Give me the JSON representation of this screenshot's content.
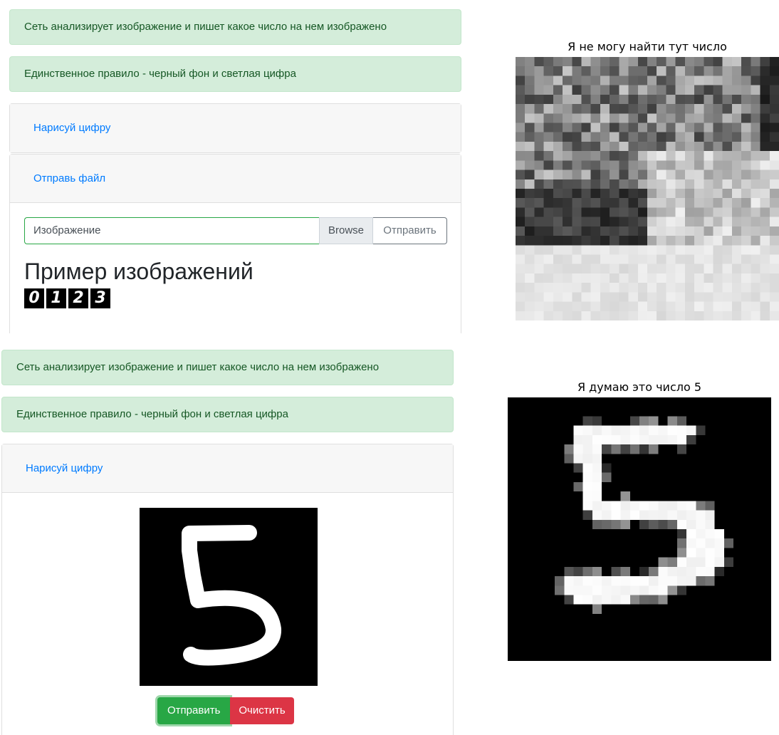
{
  "top_panel": {
    "alert1": "Сеть анализирует изображение и пишет какое число на нем изображено",
    "alert2": "Единственное правило - черный фон и светлая цифра",
    "draw_link": "Нарисуй цифру",
    "upload_link": "Отправь файл",
    "file_placeholder": "Изображение",
    "browse_label": "Browse",
    "send_label": "Отправить",
    "examples_title": "Пример изображений",
    "example_digits": [
      "0",
      "1",
      "2",
      "3"
    ]
  },
  "top_result": {
    "title": "Я не могу найти тут число"
  },
  "bottom_panel": {
    "alert1": "Сеть анализирует изображение и пишет какое число на нем изображено",
    "alert2": "Единственное правило - черный фон и светлая цифра",
    "draw_link": "Нарисуй цифру",
    "send_label": "Отправить",
    "clear_label": "Очистить"
  },
  "bottom_result": {
    "title": "Я думаю это число 5"
  }
}
